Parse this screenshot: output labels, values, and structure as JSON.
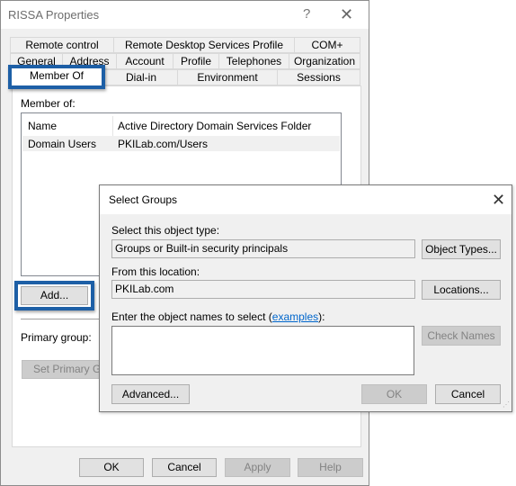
{
  "main_window": {
    "title": "RISSA Properties",
    "help_glyph": "?",
    "close_glyph": "✕",
    "tabs_row1": [
      "Remote control",
      "Remote Desktop Services Profile",
      "COM+"
    ],
    "tabs_row2": [
      "General",
      "Address",
      "Account",
      "Profile",
      "Telephones",
      "Organization"
    ],
    "tabs_row3": [
      "Member Of",
      "Dial-in",
      "Environment",
      "Sessions"
    ],
    "active_tab": "Member Of",
    "member_of_label": "Member of:",
    "list": {
      "columns": [
        "Name",
        "Active Directory Domain Services Folder"
      ],
      "rows": [
        {
          "name": "Domain Users",
          "folder": "PKILab.com/Users"
        }
      ]
    },
    "add_button": "Add...",
    "primary_group_label": "Primary group:",
    "set_primary_group_button": "Set Primary Group",
    "footer_buttons": {
      "ok": "OK",
      "cancel": "Cancel",
      "apply": "Apply",
      "help": "Help"
    },
    "highlight_color": "#1d5fa6"
  },
  "select_groups_dialog": {
    "title": "Select Groups",
    "close_glyph": "✕",
    "object_type_label": "Select this object type:",
    "object_type_value": "Groups or Built-in security principals",
    "object_types_button": "Object Types...",
    "location_label": "From this location:",
    "location_value": "PKILab.com",
    "locations_button": "Locations...",
    "names_label_prefix": "Enter the object names to select (",
    "names_label_link": "examples",
    "names_label_suffix": "):",
    "names_value": "",
    "check_names_button": "Check Names",
    "advanced_button": "Advanced...",
    "ok_button": "OK",
    "cancel_button": "Cancel"
  }
}
